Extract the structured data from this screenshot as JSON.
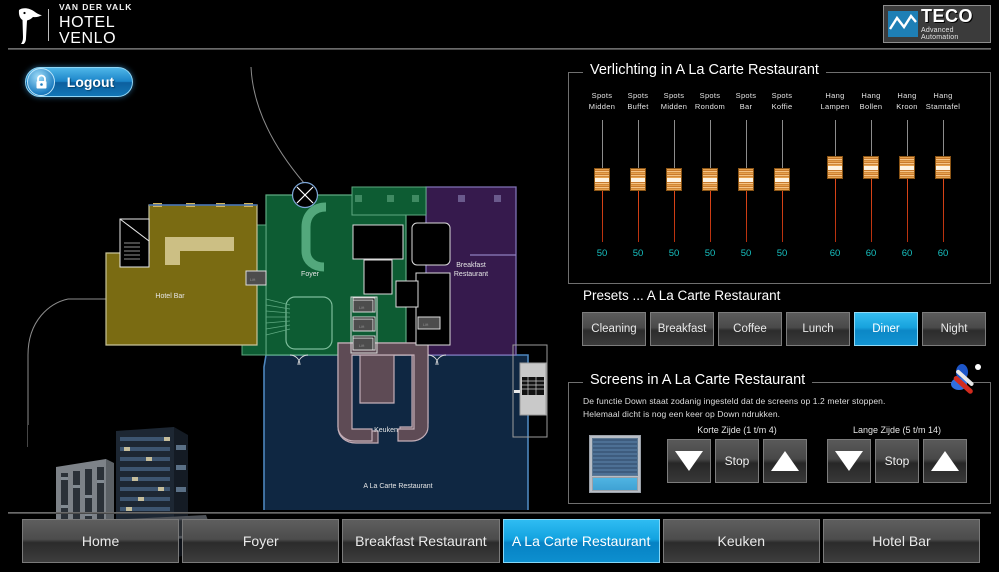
{
  "header": {
    "brand_small": "VAN DER VALK",
    "brand_big": "HOTEL VENLO",
    "bird_icon": "toucan-logo-icon",
    "teco_name": "TECO",
    "teco_sub": "Advanced Automation"
  },
  "left": {
    "logout_label": "Logout",
    "lock_icon": "lock-icon",
    "floorplan_zones": [
      {
        "label": "Hotel Bar",
        "color": "#7a6b12"
      },
      {
        "label": "Foyer",
        "color": "#0d5c33"
      },
      {
        "label": "Breakfast\nRestaurant",
        "color": "#361a4d"
      },
      {
        "label": "Keuken",
        "color": "#5e4b55"
      },
      {
        "label": "A La Carte Restaurant",
        "color": "#0f2742"
      }
    ],
    "zone_labels": {
      "hotel_bar": "Hotel Bar",
      "foyer": "Foyer",
      "breakfast_line1": "Breakfast",
      "breakfast_line2": "Restaurant",
      "keuken": "Keuken",
      "alacarte": "A La Carte Restaurant"
    },
    "building_photo_alt": "hotel-building-photo"
  },
  "lighting": {
    "title": "Verlichting in A La Carte Restaurant",
    "sliders": [
      {
        "line1": "Spots",
        "line2": "Midden",
        "value": "50"
      },
      {
        "line1": "Spots",
        "line2": "Buffet",
        "value": "50"
      },
      {
        "line1": "Spots",
        "line2": "Midden",
        "value": "50"
      },
      {
        "line1": "Spots",
        "line2": "Rondom",
        "value": "50"
      },
      {
        "line1": "Spots",
        "line2": "Bar",
        "value": "50"
      },
      {
        "line1": "Spots",
        "line2": "Koffie",
        "value": "50"
      },
      {
        "line1": "Hang",
        "line2": "Lampen",
        "value": "60"
      },
      {
        "line1": "Hang",
        "line2": "Bollen",
        "value": "60"
      },
      {
        "line1": "Hang",
        "line2": "Kroon",
        "value": "60"
      },
      {
        "line1": "Hang",
        "line2": "Stamtafel",
        "value": "60"
      }
    ]
  },
  "presets": {
    "title": "Presets ... A La Carte Restaurant",
    "buttons": [
      {
        "label": "Cleaning",
        "active": false
      },
      {
        "label": "Breakfast",
        "active": false
      },
      {
        "label": "Coffee",
        "active": false
      },
      {
        "label": "Lunch",
        "active": false
      },
      {
        "label": "Diner",
        "active": true
      },
      {
        "label": "Night",
        "active": false
      }
    ]
  },
  "screens": {
    "title": "Screens in A La Carte Restaurant",
    "tools_icon": "tools-wrench-screwdriver-icon",
    "description_line1": "De functie Down staat zodanig ingesteld dat de screens op 1.2 meter stoppen.",
    "description_line2": "Helemaal dicht is nog een keer op Down ndrukken.",
    "blind_icon": "window-blind-icon",
    "groups": [
      {
        "label": "Korte Zijde (1 t/m 4)",
        "down_icon": "triangle-down-icon",
        "stop_label": "Stop",
        "up_icon": "triangle-up-icon"
      },
      {
        "label": "Lange Zijde (5 t/m 14)",
        "down_icon": "triangle-down-icon",
        "stop_label": "Stop",
        "up_icon": "triangle-up-icon"
      }
    ]
  },
  "nav": {
    "tabs": [
      {
        "label": "Home",
        "active": false
      },
      {
        "label": "Foyer",
        "active": false
      },
      {
        "label": "Breakfast Restaurant",
        "active": false
      },
      {
        "label": "A La Carte Restaurant",
        "active": true
      },
      {
        "label": "Keuken",
        "active": false
      },
      {
        "label": "Hotel Bar",
        "active": false
      }
    ]
  },
  "colors": {
    "accent": "#13a3e0",
    "value_text": "#17c0c0",
    "panel_border": "#6f6f6f"
  }
}
